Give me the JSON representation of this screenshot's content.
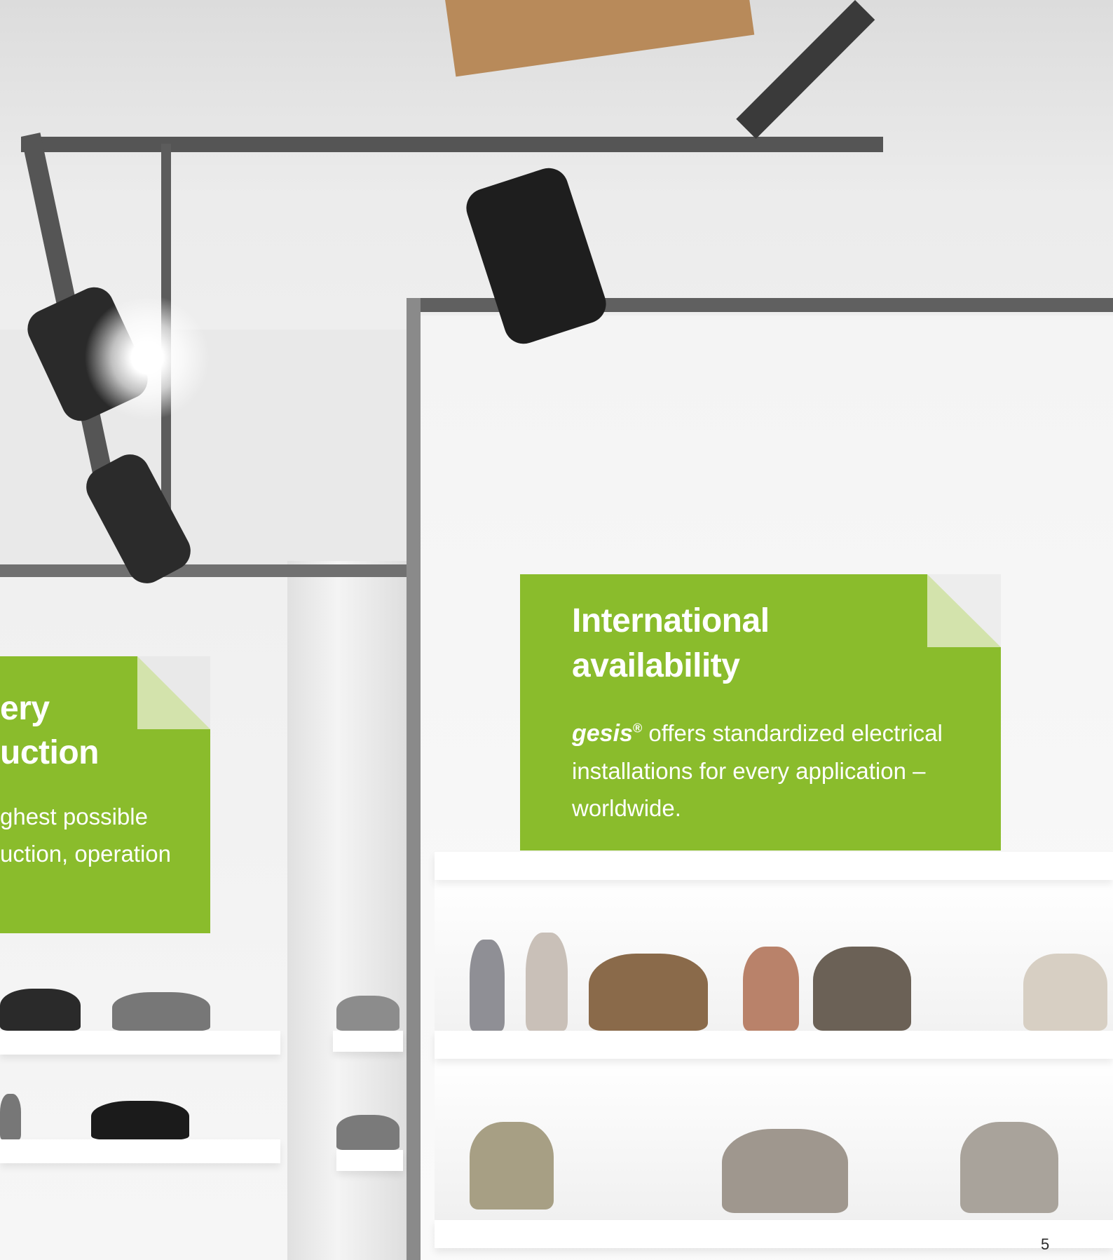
{
  "cards": {
    "left": {
      "title_line1": "ery",
      "title_line2": "uction",
      "body_line1": "ghest possible",
      "body_line2": "uction, operation"
    },
    "right": {
      "title_line1": "International",
      "title_line2": "availability",
      "brand": "gesis",
      "brand_mark": "®",
      "body_line1": " offers standardized electrical",
      "body_line2": "installations for every application –",
      "body_line3": "worldwide."
    }
  },
  "colors": {
    "card_green": "#8abc2c",
    "card_fold": "#d3e3ac"
  },
  "page": {
    "number": "5"
  }
}
